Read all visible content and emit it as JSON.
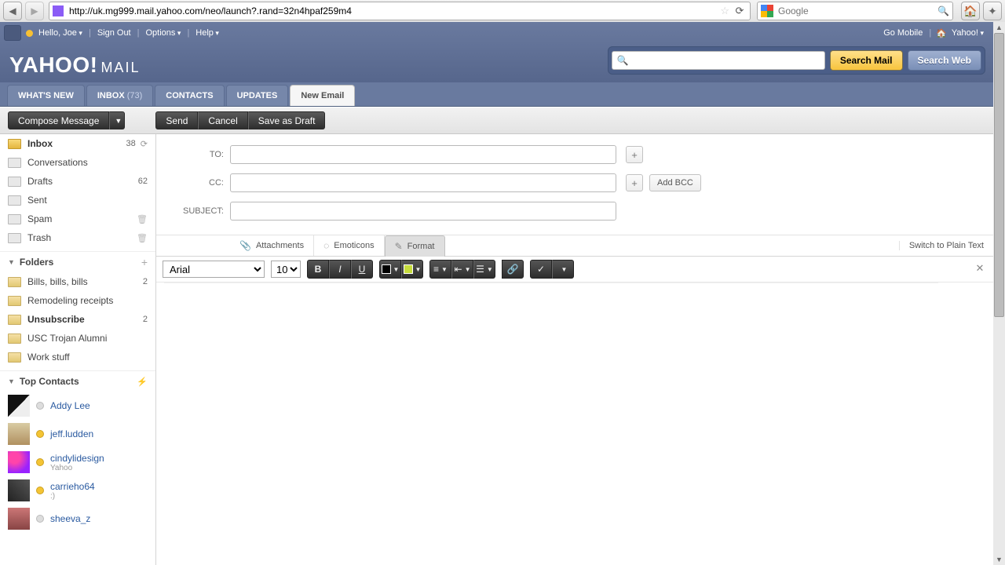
{
  "browser": {
    "url": "http://uk.mg999.mail.yahoo.com/neo/launch?.rand=32n4hpaf259m4",
    "search_placeholder": "Google"
  },
  "topbar": {
    "hello": "Hello, Joe",
    "signout": "Sign Out",
    "options": "Options",
    "help": "Help",
    "gomobile": "Go Mobile",
    "yahoo": "Yahoo!"
  },
  "logo": {
    "main": "YAHOO!",
    "sub": "MAIL"
  },
  "searchbar": {
    "search_mail": "Search Mail",
    "search_web": "Search Web"
  },
  "tabs": {
    "whatsnew": "WHAT'S NEW",
    "inbox": "INBOX",
    "inbox_count": "(73)",
    "contacts": "CONTACTS",
    "updates": "UPDATES",
    "newemail": "New Email"
  },
  "toolbar": {
    "compose": "Compose Message",
    "send": "Send",
    "cancel": "Cancel",
    "draft": "Save as Draft"
  },
  "mailboxes": {
    "inbox": {
      "label": "Inbox",
      "count": "38"
    },
    "conversations": "Conversations",
    "drafts": {
      "label": "Drafts",
      "count": "62"
    },
    "sent": "Sent",
    "spam": "Spam",
    "trash": "Trash"
  },
  "folders": {
    "header": "Folders",
    "items": [
      {
        "label": "Bills, bills, bills",
        "count": "2"
      },
      {
        "label": "Remodeling receipts",
        "count": ""
      },
      {
        "label": "Unsubscribe",
        "count": "2"
      },
      {
        "label": "USC Trojan Alumni",
        "count": ""
      },
      {
        "label": "Work stuff",
        "count": ""
      }
    ]
  },
  "contacts": {
    "header": "Top Contacts",
    "items": [
      {
        "name": "Addy Lee",
        "sub": ""
      },
      {
        "name": "jeff.ludden",
        "sub": ""
      },
      {
        "name": "cindylidesign",
        "sub": "Yahoo"
      },
      {
        "name": "carrieho64",
        "sub": ":)"
      },
      {
        "name": "sheeva_z",
        "sub": ""
      }
    ]
  },
  "compose": {
    "to_label": "TO:",
    "cc_label": "CC:",
    "subject_label": "SUBJECT:",
    "add_bcc": "Add BCC",
    "attachments": "Attachments",
    "emoticons": "Emoticons",
    "format": "Format",
    "plain": "Switch to Plain Text"
  },
  "editor": {
    "font": "Arial",
    "size": "10",
    "btn": {
      "b": "B",
      "i": "I",
      "u": "U",
      "link": "🔗",
      "check": "✓"
    }
  }
}
